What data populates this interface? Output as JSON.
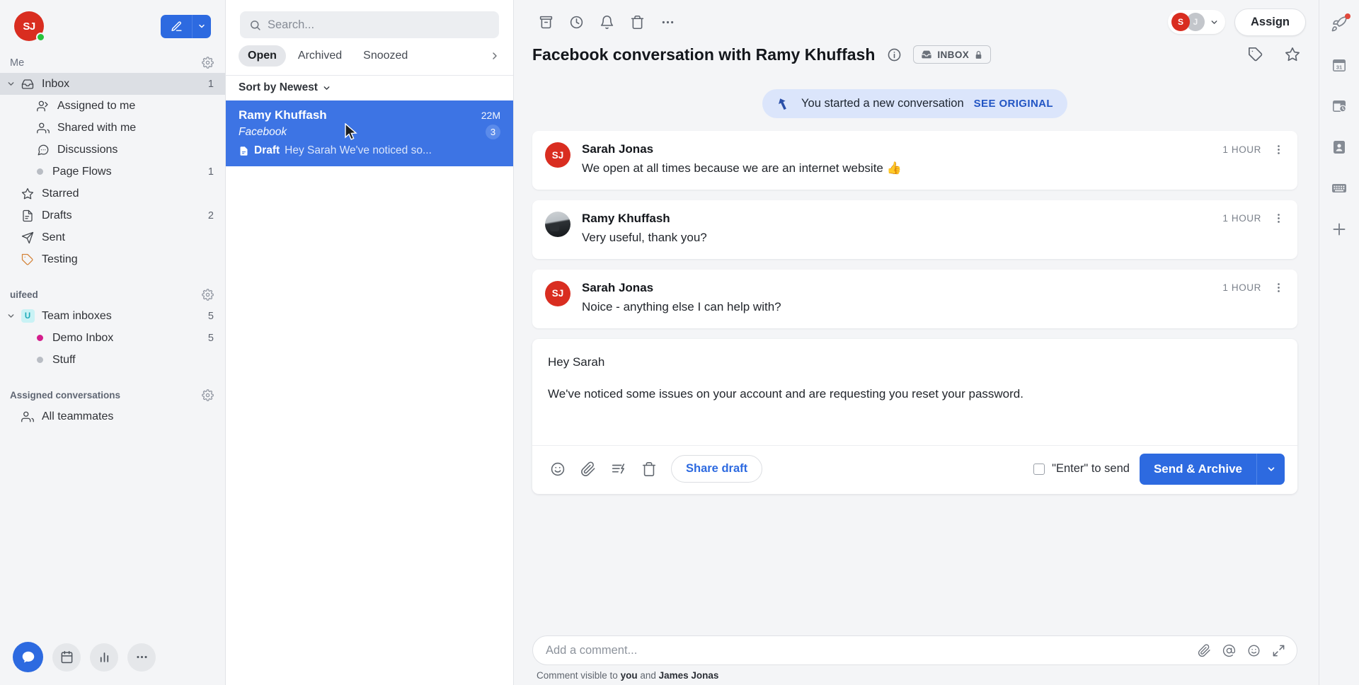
{
  "sidebar": {
    "user_avatar_initials": "SJ",
    "user_status": "online",
    "compose_label": "compose",
    "sections": [
      {
        "title": "Me",
        "has_gear": true,
        "items": [
          {
            "label": "Inbox",
            "icon": "inbox-icon",
            "count": "1",
            "active": true,
            "expandable": true
          },
          {
            "label": "Assigned to me",
            "icon": "assigned-icon",
            "count": "",
            "indent": true
          },
          {
            "label": "Shared with me",
            "icon": "people-icon",
            "count": "",
            "indent": true
          },
          {
            "label": "Discussions",
            "icon": "chat-icon",
            "count": "",
            "indent": true
          },
          {
            "label": "Page Flows",
            "icon": "dot-icon",
            "count": "1",
            "indent": true
          },
          {
            "label": "Starred",
            "icon": "star-icon",
            "count": ""
          },
          {
            "label": "Drafts",
            "icon": "draft-icon",
            "count": "2"
          },
          {
            "label": "Sent",
            "icon": "send-icon",
            "count": ""
          },
          {
            "label": "Testing",
            "icon": "tag-icon",
            "count": ""
          }
        ]
      },
      {
        "title": "uifeed",
        "has_gear": true,
        "items": [
          {
            "label": "Team inboxes",
            "icon": "team-badge-u",
            "count": "5",
            "expandable": true
          },
          {
            "label": "Demo Inbox",
            "icon": "dot-magenta",
            "count": "5",
            "indent": true
          },
          {
            "label": "Stuff",
            "icon": "dot-icon",
            "count": "",
            "indent": true
          }
        ]
      },
      {
        "title": "Assigned conversations",
        "has_gear": true,
        "items": [
          {
            "label": "All teammates",
            "icon": "people-icon",
            "count": ""
          }
        ]
      }
    ],
    "bottom_buttons": [
      "messages-icon",
      "calendar-icon",
      "analytics-icon",
      "more-icon"
    ]
  },
  "conversation_list": {
    "search": {
      "placeholder": "Search...",
      "value": ""
    },
    "tabs": [
      {
        "label": "Open",
        "active": true
      },
      {
        "label": "Archived",
        "active": false
      },
      {
        "label": "Snoozed",
        "active": false
      }
    ],
    "sort_label": "Sort by Newest",
    "rows": [
      {
        "name": "Ramy Khuffash",
        "time": "22M",
        "channel": "Facebook",
        "badge": "3",
        "draft_label": "Draft",
        "preview": "Hey Sarah We've noticed so...",
        "selected": true
      }
    ]
  },
  "thread": {
    "toolbar_icons": [
      "archive-icon",
      "snooze-icon",
      "bell-icon",
      "trash-icon",
      "more-icon"
    ],
    "assignees": [
      {
        "initials": "S",
        "color": "#d92d20"
      },
      {
        "initials": "J",
        "color": "#c3c6cb"
      }
    ],
    "assign_button": "Assign",
    "subject": "Facebook conversation with Ramy Khuffash",
    "inbox_chip": "INBOX",
    "banner": {
      "text": "You started a new conversation",
      "link": "SEE ORIGINAL"
    },
    "messages": [
      {
        "author": "Sarah Jonas",
        "avatar_initials": "SJ",
        "avatar_type": "initials",
        "time": "1 HOUR",
        "text": "We open at all times because we are an internet website 👍"
      },
      {
        "author": "Ramy Khuffash",
        "avatar_initials": "",
        "avatar_type": "photo",
        "time": "1 HOUR",
        "text": "Very useful, thank you?"
      },
      {
        "author": "Sarah Jonas",
        "avatar_initials": "SJ",
        "avatar_type": "initials",
        "time": "1 HOUR",
        "text": "Noice - anything else I can help with?"
      }
    ],
    "draft": {
      "greeting": "Hey Sarah",
      "body": "We've noticed some issues on your account and are requesting you reset your password.",
      "toolbar_icons": [
        "emoji-icon",
        "attachment-icon",
        "macro-icon",
        "trash-icon"
      ],
      "share_draft_label": "Share draft",
      "enter_to_send_label": "\"Enter\" to send",
      "enter_to_send_checked": false,
      "send_label": "Send & Archive"
    }
  },
  "comment_bar": {
    "placeholder": "Add a comment...",
    "value": "",
    "icons": [
      "attachment-icon",
      "mention-icon",
      "emoji-icon",
      "expand-icon"
    ],
    "note_prefix": "Comment visible to",
    "note_you": "you",
    "note_and": "and",
    "note_person": "James Jonas"
  },
  "right_rail": {
    "icons": [
      {
        "name": "rocket-icon",
        "has_dot": true
      },
      {
        "name": "calendar-31-icon",
        "has_dot": false
      },
      {
        "name": "history-icon",
        "has_dot": false
      },
      {
        "name": "contact-icon",
        "has_dot": false
      },
      {
        "name": "keyboard-icon",
        "has_dot": false
      },
      {
        "name": "plus-icon",
        "has_dot": false
      }
    ]
  },
  "colors": {
    "accent_blue": "#2d6ae0",
    "selected_row": "#3d74e4",
    "avatar_red": "#d92d20",
    "banner_bg": "#dbe5fb",
    "magenta_dot": "#d41e8c"
  }
}
